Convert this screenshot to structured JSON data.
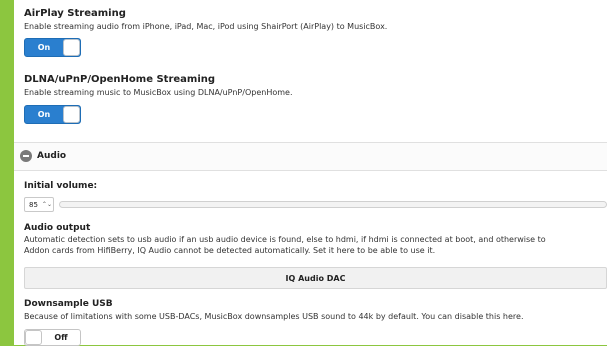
{
  "airplay": {
    "title": "AirPlay Streaming",
    "description": "Enable streaming audio from iPhone, iPad, Mac, iPod using ShairPort (AirPlay) to MusicBox.",
    "toggle_label": "On"
  },
  "dlna": {
    "title": "DLNA/uPnP/OpenHome Streaming",
    "description": "Enable streaming music to MusicBox using DLNA/uPnP/OpenHome.",
    "toggle_label": "On"
  },
  "audio_section": {
    "label": "Audio"
  },
  "initial_volume": {
    "title": "Initial volume:",
    "value": "85",
    "arrows": "⌃⌄"
  },
  "audio_output": {
    "title": "Audio output",
    "description_line1": "Automatic detection sets to usb audio if an usb audio device is found, else to hdmi, if hdmi is connected at boot, and otherwise to",
    "description_line2": "Addon cards from HifiBerry, IQ Audio cannot be detected automatically. Set it here to be able to use it.",
    "selected": "IQ Audio DAC"
  },
  "downsample": {
    "title": "Downsample USB",
    "description": "Because of limitations with some USB-DACs, MusicBox downsamples USB sound to 44k by default. You can disable this here.",
    "toggle_label": "Off"
  },
  "colors": {
    "background_green": "#8cc63f",
    "toggle_on_blue": "#2a7fcf"
  }
}
